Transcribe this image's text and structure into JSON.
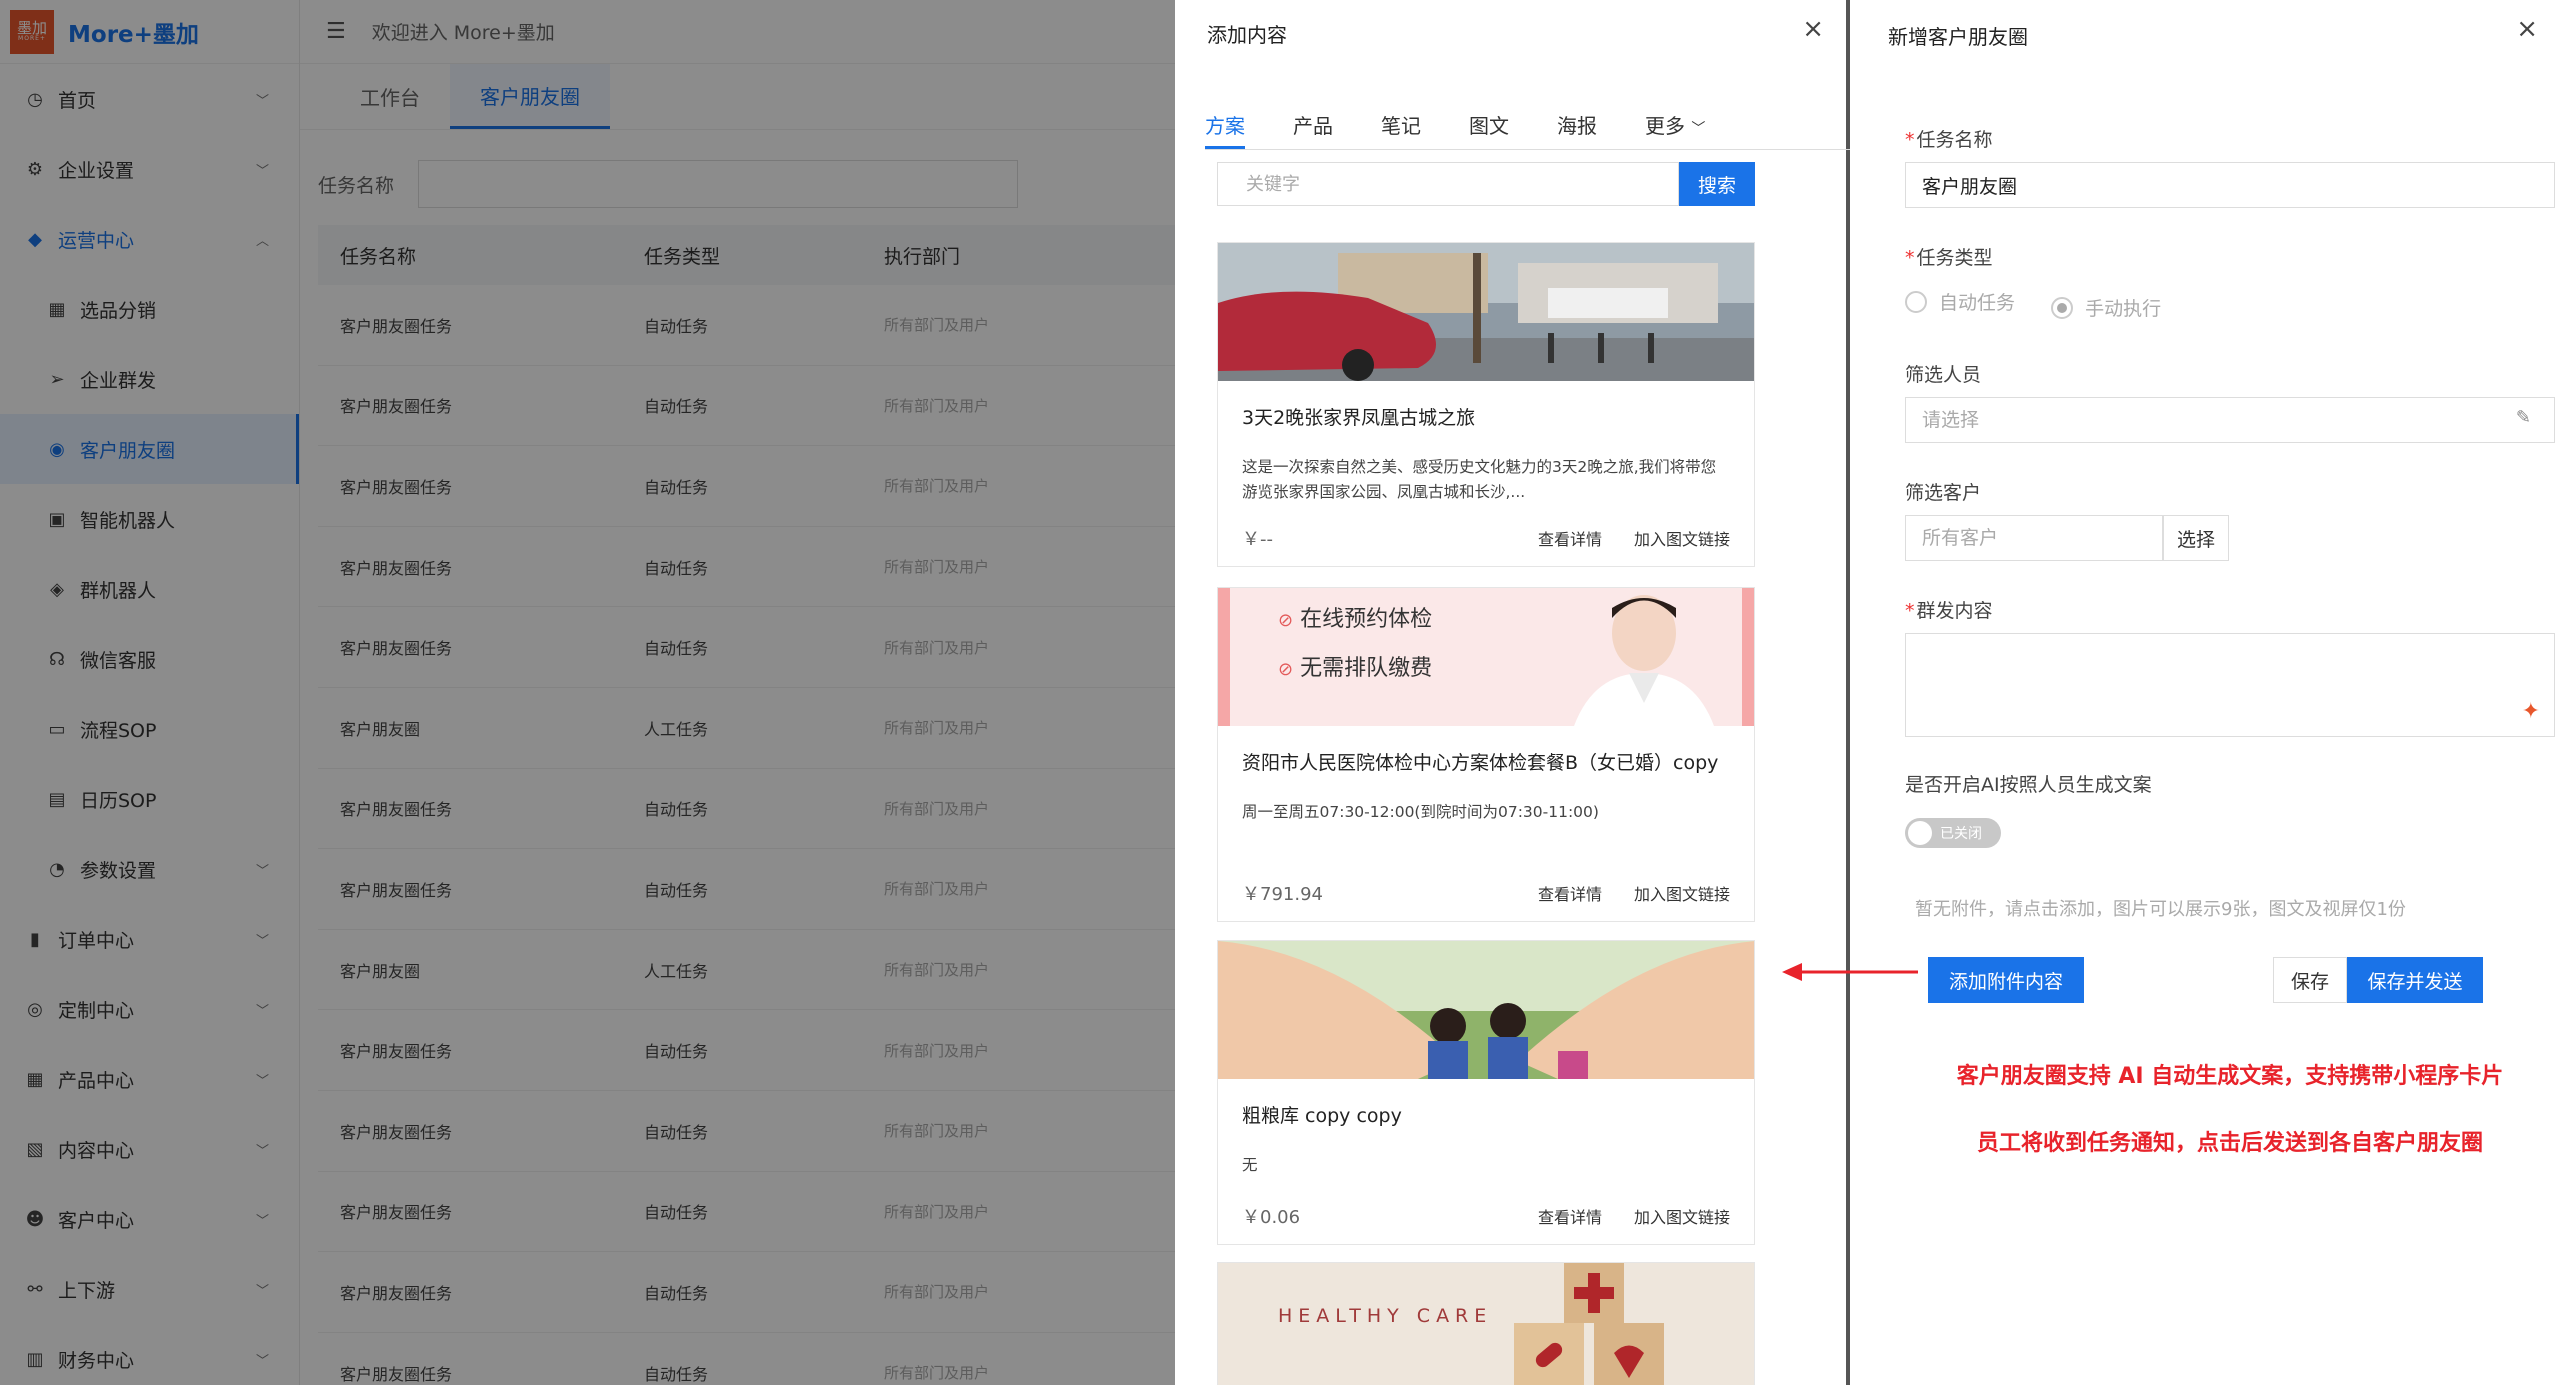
{
  "app": {
    "logo_text": "墨加",
    "logo_sub": "MORE+",
    "name": "More+墨加",
    "welcome": "欢迎进入 More+墨加"
  },
  "sidebar": {
    "items": [
      {
        "label": "首页",
        "icon": "dashboard-icon",
        "glyph": "◷"
      },
      {
        "label": "企业设置",
        "icon": "gear-icon",
        "glyph": "⚙"
      },
      {
        "label": "运营中心",
        "icon": "megaphone-icon",
        "glyph": "◆"
      },
      {
        "label": "选品分销",
        "icon": "grid-icon",
        "glyph": "▦"
      },
      {
        "label": "企业群发",
        "icon": "send-icon",
        "glyph": "➢"
      },
      {
        "label": "客户朋友圈",
        "icon": "circle-icon",
        "glyph": "◉"
      },
      {
        "label": "智能机器人",
        "icon": "robot-icon",
        "glyph": "▣"
      },
      {
        "label": "群机器人",
        "icon": "group-robot-icon",
        "glyph": "◈"
      },
      {
        "label": "微信客服",
        "icon": "headset-icon",
        "glyph": "☊"
      },
      {
        "label": "流程SOP",
        "icon": "flow-icon",
        "glyph": "▭"
      },
      {
        "label": "日历SOP",
        "icon": "calendar-icon",
        "glyph": "▤"
      },
      {
        "label": "参数设置",
        "icon": "params-icon",
        "glyph": "◔"
      },
      {
        "label": "订单中心",
        "icon": "order-icon",
        "glyph": "▮"
      },
      {
        "label": "定制中心",
        "icon": "compass-icon",
        "glyph": "◎"
      },
      {
        "label": "产品中心",
        "icon": "product-icon",
        "glyph": "▦"
      },
      {
        "label": "内容中心",
        "icon": "content-icon",
        "glyph": "▧"
      },
      {
        "label": "客户中心",
        "icon": "users-icon",
        "glyph": "☻"
      },
      {
        "label": "上下游",
        "icon": "link-icon",
        "glyph": "⚯"
      },
      {
        "label": "财务中心",
        "icon": "finance-icon",
        "glyph": "▥"
      }
    ]
  },
  "page": {
    "tabs": [
      "工作台",
      "客户朋友圈"
    ],
    "filter_label": "任务名称",
    "columns": [
      "任务名称",
      "任务类型",
      "执行部门"
    ],
    "rows": [
      [
        "客户朋友圈任务",
        "自动任务",
        "所有部门及用户"
      ],
      [
        "客户朋友圈任务",
        "自动任务",
        "所有部门及用户"
      ],
      [
        "客户朋友圈任务",
        "自动任务",
        "所有部门及用户"
      ],
      [
        "客户朋友圈任务",
        "自动任务",
        "所有部门及用户"
      ],
      [
        "客户朋友圈任务",
        "自动任务",
        "所有部门及用户"
      ],
      [
        "客户朋友圈",
        "人工任务",
        "所有部门及用户"
      ],
      [
        "客户朋友圈任务",
        "自动任务",
        "所有部门及用户"
      ],
      [
        "客户朋友圈任务",
        "自动任务",
        "所有部门及用户"
      ],
      [
        "客户朋友圈",
        "人工任务",
        "所有部门及用户"
      ],
      [
        "客户朋友圈任务",
        "自动任务",
        "所有部门及用户"
      ],
      [
        "客户朋友圈任务",
        "自动任务",
        "所有部门及用户"
      ],
      [
        "客户朋友圈任务",
        "自动任务",
        "所有部门及用户"
      ],
      [
        "客户朋友圈任务",
        "自动任务",
        "所有部门及用户"
      ],
      [
        "客户朋友圈任务",
        "自动任务",
        "所有部门及用户"
      ]
    ]
  },
  "add_panel": {
    "title": "添加内容",
    "tabs": [
      "方案",
      "产品",
      "笔记",
      "图文",
      "海报",
      "更多"
    ],
    "search_placeholder": "关键字",
    "search_button": "搜索",
    "detail_link": "查看详情",
    "add_link": "加入图文链接",
    "cards": [
      {
        "title": "3天2晚张家界凤凰古城之旅",
        "desc": "这是一次探索自然之美、感受历史文化魅力的3天2晚之旅,我们将带您游览张家界国家公园、凤凰古城和长沙,...",
        "price": "￥--"
      },
      {
        "title": "资阳市人民医院体检中心方案体检套餐B（女已婚）copy",
        "desc": "周一至周五07:30-12:00(到院时间为07:30-11:00)",
        "price": "￥791.94",
        "banner": [
          "在线预约体检",
          "无需排队缴费"
        ]
      },
      {
        "title": "粗粮库 copy copy",
        "desc": "无",
        "price": "￥0.06"
      },
      {
        "banner_text": "HEALTHY CARE"
      }
    ]
  },
  "new_panel": {
    "title": "新增客户朋友圈",
    "task_name_label": "任务名称",
    "task_name_value": "客户朋友圈",
    "task_type_label": "任务类型",
    "task_type_options": [
      "自动任务",
      "手动执行"
    ],
    "filter_staff_label": "筛选人员",
    "filter_staff_placeholder": "请选择",
    "filter_customer_label": "筛选客户",
    "filter_customer_placeholder": "所有客户",
    "select_button": "选择",
    "content_label": "群发内容",
    "ai_label": "是否开启AI按照人员生成文案",
    "toggle_label": "已关闭",
    "attachment_hint": "暂无附件，请点击添加，图片可以展示9张，图文及视屏仅1份",
    "add_attachment": "添加附件内容",
    "save": "保存",
    "save_send": "保存并发送",
    "note_1": "客户朋友圈支持 AI 自动生成文案，支持携带小程序卡片",
    "note_2": "员工将收到任务通知，点击后发送到各自客户朋友圈"
  }
}
